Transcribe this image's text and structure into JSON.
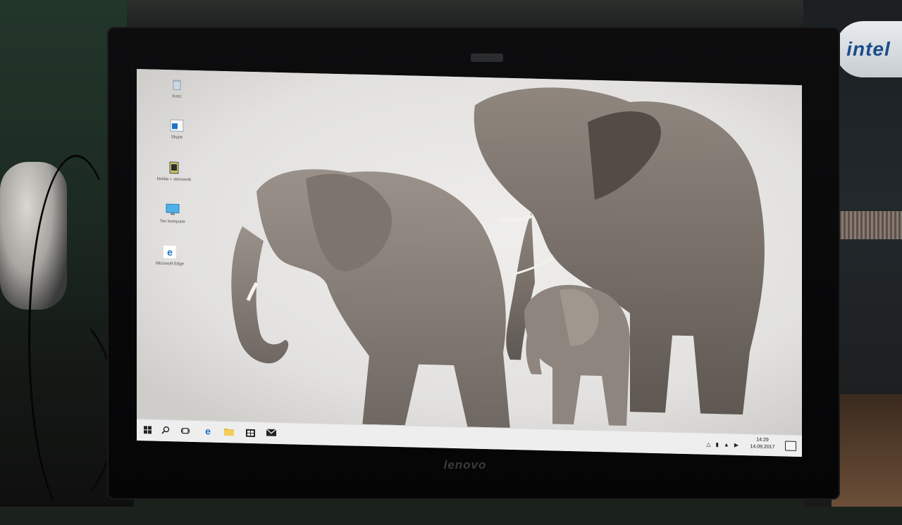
{
  "environment": {
    "intel_label": "intel",
    "monitor_brand": "lenovo"
  },
  "desktop": {
    "icons": [
      {
        "label": "Kosz",
        "icon": "recycle-bin-icon"
      },
      {
        "label": "Skype",
        "icon": "shortcut-icon"
      },
      {
        "label": "Nvidia + sterownik",
        "icon": "app-shortcut-icon"
      },
      {
        "label": "Ten komputer",
        "icon": "computer-icon"
      },
      {
        "label": "Microsoft Edge",
        "icon": "edge-icon"
      }
    ]
  },
  "taskbar": {
    "buttons": [
      {
        "name": "start-button",
        "icon": "windows-logo-icon"
      },
      {
        "name": "search-button",
        "icon": "search-icon"
      },
      {
        "name": "task-view-button",
        "icon": "task-view-icon"
      },
      {
        "name": "edge-taskbar-button",
        "icon": "edge-icon"
      },
      {
        "name": "file-explorer-button",
        "icon": "folder-icon"
      },
      {
        "name": "store-button",
        "icon": "store-icon"
      },
      {
        "name": "mail-button",
        "icon": "mail-icon"
      }
    ],
    "tray": {
      "time": "14:29",
      "date": "14.09.2017"
    }
  },
  "colors": {
    "accent": "#1a73c8",
    "taskbar_bg": "#eeeeef"
  }
}
